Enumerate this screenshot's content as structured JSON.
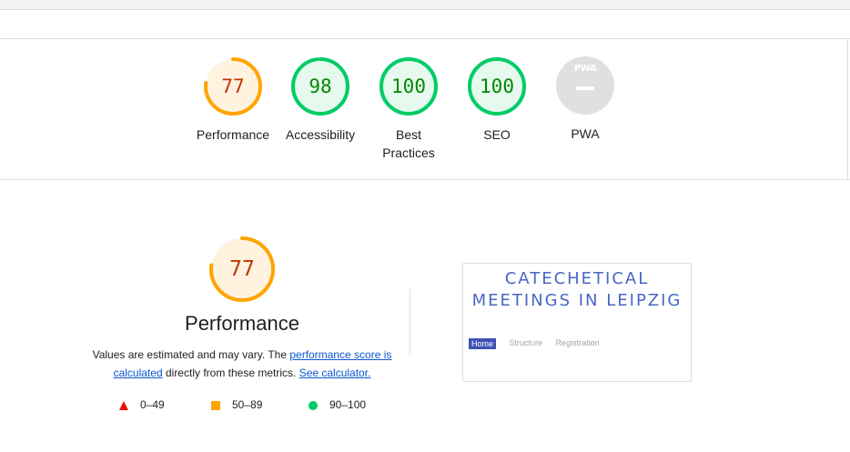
{
  "categories": [
    {
      "label": "Performance",
      "score": "77",
      "value": 0.77,
      "rating": "average",
      "color": "#ffa400"
    },
    {
      "label": "Accessibility",
      "score": "98",
      "value": 0.98,
      "rating": "pass",
      "color": "#00cc66"
    },
    {
      "label": "Best Practices",
      "score": "100",
      "value": 1.0,
      "rating": "pass",
      "color": "#00cc66"
    },
    {
      "label": "SEO",
      "score": "100",
      "value": 1.0,
      "rating": "pass",
      "color": "#00cc66"
    },
    {
      "label": "PWA",
      "badge_text": "PWA",
      "rating": "na",
      "color": "#e0e0e0"
    }
  ],
  "performance": {
    "title": "Performance",
    "score": "77",
    "value": 0.77,
    "desc_text_1": "Values are estimated and may vary. The ",
    "link_score": "performance score is calculated",
    "desc_text_2": " directly from these metrics. ",
    "link_calculator": "See calculator."
  },
  "legend": [
    {
      "icon": "triangle-icon",
      "label": "0–49",
      "color": "#eb0f00"
    },
    {
      "icon": "square-icon",
      "label": "50–89",
      "color": "#ffa400"
    },
    {
      "icon": "circle-icon",
      "label": "90–100",
      "color": "#00cc66"
    }
  ],
  "screenshot": {
    "site_title": "CATECHETICAL MEETINGS IN LEIPZIG",
    "nav": [
      "Home",
      "Structure",
      "Registration"
    ]
  }
}
